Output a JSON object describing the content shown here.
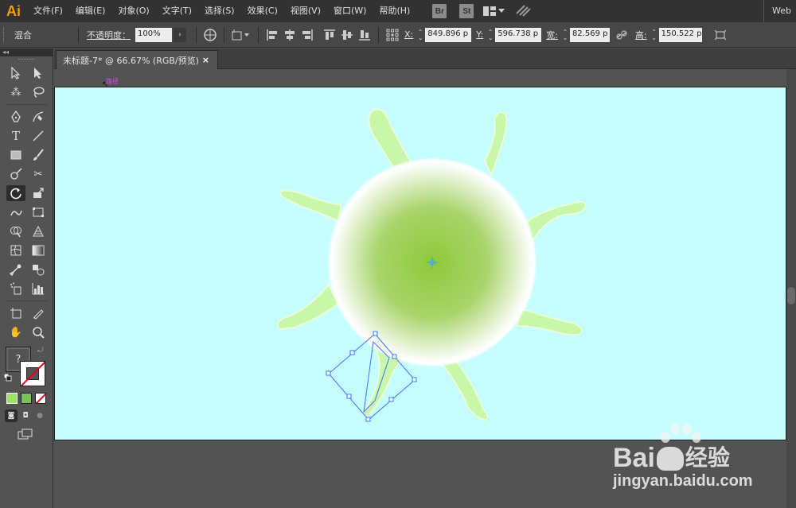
{
  "app": {
    "logo": "Ai",
    "workspace": "Web"
  },
  "menu": [
    "文件(F)",
    "编辑(E)",
    "对象(O)",
    "文字(T)",
    "选择(S)",
    "效果(C)",
    "视图(V)",
    "窗口(W)",
    "帮助(H)"
  ],
  "bridge": {
    "br": "Br",
    "st": "St"
  },
  "control": {
    "mode_label": "混合",
    "opacity_label": "不透明度：",
    "opacity_value": "100%",
    "x_label": "X:",
    "x_value": "849.896 p",
    "y_label": "Y:",
    "y_value": "596.738 p",
    "w_label": "宽:",
    "w_value": "82.569 p",
    "h_label": "高:",
    "h_value": "150.522 p"
  },
  "tabs": [
    {
      "label": "未标题-7* @ 66.67% (RGB/预览)",
      "close": "×"
    }
  ],
  "toolbox": {
    "header": "◂◂",
    "fill_unknown": "?"
  },
  "canvas": {
    "path_label": "路径",
    "artboard_color": "#c6fdff",
    "sun_center_color": "#8ec93a",
    "ray_color": "#c9f7a9"
  },
  "watermark": {
    "brand_prefix": "Bai",
    "brand_suffix": "经验",
    "url": "jingyan.baidu.com"
  }
}
